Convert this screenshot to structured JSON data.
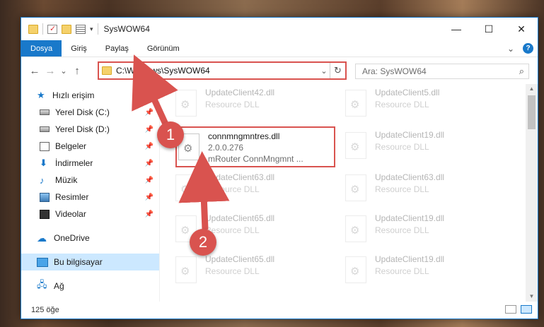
{
  "window": {
    "title": "SysWOW64",
    "minimize": "—",
    "maximize": "☐",
    "close": "✕"
  },
  "ribbon": {
    "tabs": [
      "Dosya",
      "Giriş",
      "Paylaş",
      "Görünüm"
    ],
    "expand": "⌄",
    "help": "?"
  },
  "nav": {
    "back": "←",
    "forward": "→",
    "recent": "⌄",
    "up": "↑",
    "address": "C:\\Windows\\SysWOW64",
    "address_dropdown": "⌄",
    "refresh": "↻",
    "search_placeholder": "Ara: SysWOW64",
    "search_icon": "⌕"
  },
  "sidebar": {
    "quick_access": "Hızlı erişim",
    "items": [
      {
        "label": "Yerel Disk (C:)",
        "icon": "disk-icon"
      },
      {
        "label": "Yerel Disk (D:)",
        "icon": "disk-icon"
      },
      {
        "label": "Belgeler",
        "icon": "documents-icon"
      },
      {
        "label": "İndirmeler",
        "icon": "downloads-icon"
      },
      {
        "label": "Müzik",
        "icon": "music-icon"
      },
      {
        "label": "Resimler",
        "icon": "pictures-icon"
      },
      {
        "label": "Videolar",
        "icon": "videos-icon"
      }
    ],
    "onedrive": "OneDrive",
    "this_pc": "Bu bilgisayar",
    "network": "Ağ"
  },
  "files": {
    "left": [
      {
        "name": "UpdateClient42.dll",
        "sub": "Resource DLL"
      },
      {
        "name": "connmngmntres.dll",
        "version": "2.0.0.276",
        "desc": "mRouter ConnMngmnt ..."
      },
      {
        "name": "UpdateClient63.dll",
        "sub": "Resource DLL"
      },
      {
        "name": "UpdateClient65.dll",
        "sub": "Resource DLL"
      },
      {
        "name": "UpdateClient65.dll",
        "sub": "Resource DLL"
      }
    ],
    "right": [
      {
        "name": "UpdateClient5.dll",
        "sub": "Resource DLL"
      },
      {
        "name": "UpdateClient19.dll",
        "sub": "Resource DLL"
      },
      {
        "name": "UpdateClient63.dll",
        "sub": "Resource DLL"
      },
      {
        "name": "UpdateClient19.dll",
        "sub": "Resource DLL"
      },
      {
        "name": "UpdateClient19.dll",
        "sub": "Resource DLL"
      }
    ]
  },
  "status": {
    "count": "125 öğe"
  },
  "markers": {
    "one": "1",
    "two": "2"
  },
  "colors": {
    "accent": "#1979ca",
    "highlight": "#d9534f",
    "selected": "#cce8ff"
  }
}
